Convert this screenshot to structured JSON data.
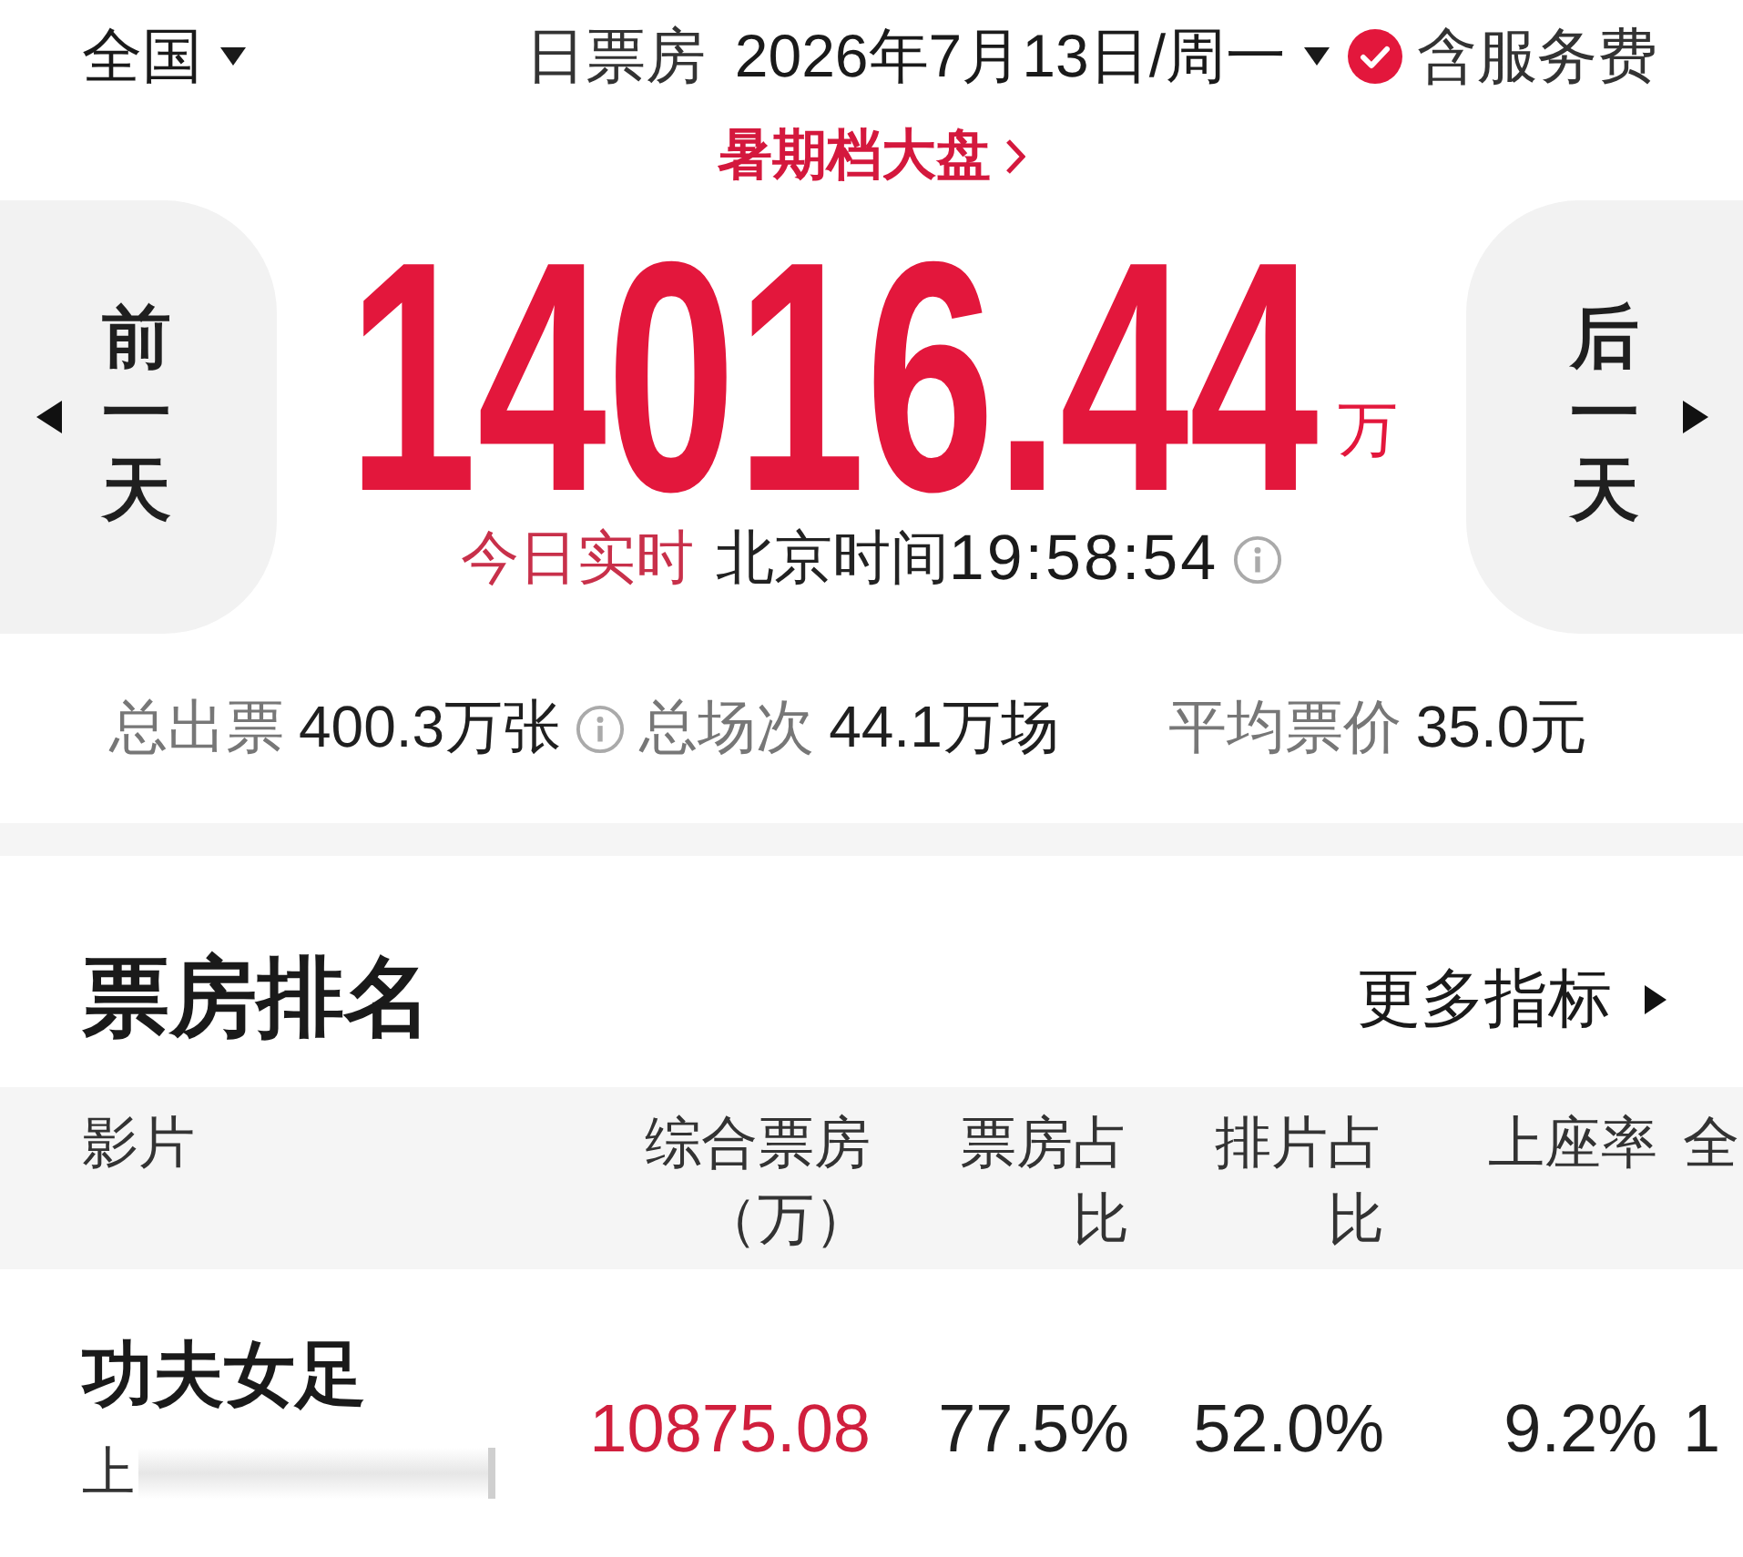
{
  "top_bar": {
    "region": {
      "label": "全国"
    },
    "report_label": "日票房",
    "date": {
      "label": "2026年7月13日/周一"
    },
    "service_fee": {
      "label": "含服务费",
      "checked": true
    }
  },
  "season_link": {
    "label": "暑期档大盘"
  },
  "hero": {
    "previous_day": {
      "label": "前一天"
    },
    "total": "14016.44",
    "unit": "万",
    "next_day": {
      "label": "后一天"
    },
    "realtime": {
      "label": "今日实时",
      "clock_label": "北京时间",
      "time": "19:58:54"
    }
  },
  "stats": [
    {
      "label": "总出票",
      "value": "400.3万张",
      "info": true
    },
    {
      "label": "总场次",
      "value": "44.1万场",
      "info": false
    },
    {
      "label": "平均票价",
      "value": "35.0元",
      "info": false
    }
  ],
  "ranking": {
    "title": "票房排名",
    "more_link": {
      "label": "更多指标"
    },
    "columns": [
      {
        "label": "影片"
      },
      {
        "label": "综合票房（万）"
      },
      {
        "label": "票房占比"
      },
      {
        "label": "排片占比"
      },
      {
        "label": "上座率"
      },
      {
        "label": "全"
      }
    ],
    "rows": [
      {
        "cells": [
          "功夫女足",
          "10875.08",
          "77.5%",
          "52.0%",
          "9.2%",
          "1"
        ],
        "subtitle": "上"
      }
    ]
  }
}
